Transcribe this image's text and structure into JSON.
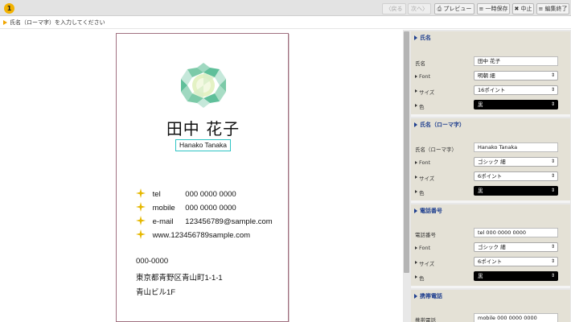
{
  "toolbar": {
    "step": "1",
    "back_label": "〈戻る",
    "next_label": "次へ〉",
    "preview_label": "プレビュー",
    "save_label": "一時保存",
    "cancel_label": "中止",
    "finish_label": "編集終了"
  },
  "instruction": "氏名（ローマ字）を入力してください",
  "card": {
    "name": "田中 花子",
    "roman": "Hanako Tanaka",
    "contacts": [
      {
        "label": "tel",
        "value": "000 0000 0000"
      },
      {
        "label": "mobile",
        "value": "000 0000 0000"
      },
      {
        "label": "e-mail",
        "value": "123456789@sample.com"
      },
      {
        "label": "",
        "value": "www.123456789sample.com"
      }
    ],
    "address": [
      "000-0000",
      "東京都青野区青山町1-1-1",
      "青山ビル1F"
    ]
  },
  "panel": {
    "sections": [
      {
        "title": "氏名",
        "field_label": "氏名",
        "field_value": "田中 花子",
        "font": "明朝 細",
        "size": "16ポイント",
        "color": "黒"
      },
      {
        "title": "氏名（ローマ字）",
        "field_label": "氏名（ローマ字）",
        "field_value": "Hanako Tanaka",
        "font": "ゴシック 細",
        "size": "6ポイント",
        "color": "黒"
      },
      {
        "title": "電話番号",
        "field_label": "電話番号",
        "field_value": "tel         000 0000 0000",
        "font": "ゴシック 細",
        "size": "6ポイント",
        "color": "黒"
      },
      {
        "title": "携帯電話",
        "field_label": "携帯電話",
        "field_value": "mobile   000 0000 0000"
      }
    ],
    "font_label": "Font",
    "size_label": "サイズ",
    "color_label": "色"
  },
  "colors": {
    "accent": "#1f3f8f",
    "badge": "#f2b200",
    "highlight": "#2ec4c4",
    "logo_green": "#6cc3a0"
  }
}
